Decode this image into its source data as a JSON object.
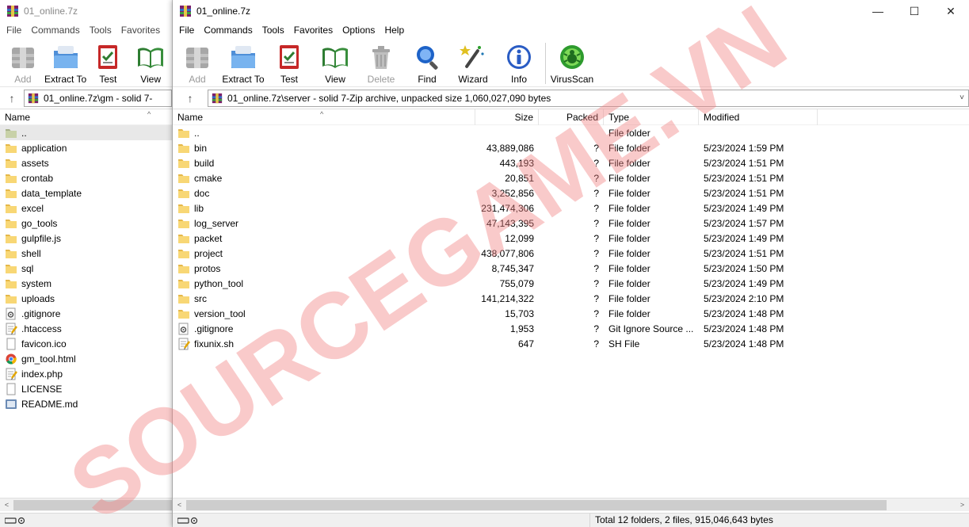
{
  "back_window": {
    "title": "01_online.7z",
    "menu": [
      "File",
      "Commands",
      "Tools",
      "Favorites"
    ],
    "toolbar": [
      {
        "label": "Add",
        "icon": "add-icon",
        "disabled": true
      },
      {
        "label": "Extract To",
        "icon": "extract-to-icon",
        "disabled": false
      },
      {
        "label": "Test",
        "icon": "test-icon",
        "disabled": false
      },
      {
        "label": "View",
        "icon": "view-icon",
        "disabled": false
      }
    ],
    "address": "01_online.7z\\gm - solid 7-",
    "column_name": "Name",
    "items": [
      {
        "name": "..",
        "kind": "up"
      },
      {
        "name": "application",
        "kind": "folder"
      },
      {
        "name": "assets",
        "kind": "folder"
      },
      {
        "name": "crontab",
        "kind": "folder"
      },
      {
        "name": "data_template",
        "kind": "folder"
      },
      {
        "name": "excel",
        "kind": "folder"
      },
      {
        "name": "go_tools",
        "kind": "folder"
      },
      {
        "name": "gulpfile.js",
        "kind": "folder"
      },
      {
        "name": "shell",
        "kind": "folder"
      },
      {
        "name": "sql",
        "kind": "folder"
      },
      {
        "name": "system",
        "kind": "folder"
      },
      {
        "name": "uploads",
        "kind": "folder"
      },
      {
        "name": ".gitignore",
        "kind": "gear"
      },
      {
        "name": ".htaccess",
        "kind": "edit"
      },
      {
        "name": "favicon.ico",
        "kind": "file"
      },
      {
        "name": "gm_tool.html",
        "kind": "chrome"
      },
      {
        "name": "index.php",
        "kind": "edit"
      },
      {
        "name": "LICENSE",
        "kind": "file"
      },
      {
        "name": "README.md",
        "kind": "md"
      }
    ]
  },
  "front_window": {
    "title": "01_online.7z",
    "window_buttons": {
      "minimize": "—",
      "maximize": "☐",
      "close": "✕"
    },
    "menu": [
      "File",
      "Commands",
      "Tools",
      "Favorites",
      "Options",
      "Help"
    ],
    "toolbar": [
      {
        "label": "Add",
        "icon": "add-icon",
        "disabled": true
      },
      {
        "label": "Extract To",
        "icon": "extract-to-icon",
        "disabled": false
      },
      {
        "label": "Test",
        "icon": "test-icon",
        "disabled": false
      },
      {
        "label": "View",
        "icon": "view-icon",
        "disabled": false
      },
      {
        "label": "Delete",
        "icon": "delete-icon",
        "disabled": true
      },
      {
        "label": "Find",
        "icon": "find-icon",
        "disabled": false
      },
      {
        "label": "Wizard",
        "icon": "wizard-icon",
        "disabled": false
      },
      {
        "label": "Info",
        "icon": "info-icon",
        "disabled": false
      },
      {
        "label": "VirusScan",
        "icon": "virusscan-icon",
        "disabled": false
      }
    ],
    "address": "01_online.7z\\server - solid 7-Zip archive, unpacked size 1,060,027,090 bytes",
    "columns": {
      "name": "Name",
      "size": "Size",
      "packed": "Packed",
      "type": "Type",
      "modified": "Modified"
    },
    "rows": [
      {
        "name": "..",
        "size": "",
        "packed": "",
        "type": "File folder",
        "modified": "",
        "kind": "folder"
      },
      {
        "name": "bin",
        "size": "43,889,086",
        "packed": "?",
        "type": "File folder",
        "modified": "5/23/2024 1:59 PM",
        "kind": "folder"
      },
      {
        "name": "build",
        "size": "443,193",
        "packed": "?",
        "type": "File folder",
        "modified": "5/23/2024 1:51 PM",
        "kind": "folder"
      },
      {
        "name": "cmake",
        "size": "20,851",
        "packed": "?",
        "type": "File folder",
        "modified": "5/23/2024 1:51 PM",
        "kind": "folder"
      },
      {
        "name": "doc",
        "size": "3,252,856",
        "packed": "?",
        "type": "File folder",
        "modified": "5/23/2024 1:51 PM",
        "kind": "folder"
      },
      {
        "name": "lib",
        "size": "231,474,306",
        "packed": "?",
        "type": "File folder",
        "modified": "5/23/2024 1:49 PM",
        "kind": "folder"
      },
      {
        "name": "log_server",
        "size": "47,143,395",
        "packed": "?",
        "type": "File folder",
        "modified": "5/23/2024 1:57 PM",
        "kind": "folder"
      },
      {
        "name": "packet",
        "size": "12,099",
        "packed": "?",
        "type": "File folder",
        "modified": "5/23/2024 1:49 PM",
        "kind": "folder"
      },
      {
        "name": "project",
        "size": "438,077,806",
        "packed": "?",
        "type": "File folder",
        "modified": "5/23/2024 1:51 PM",
        "kind": "folder"
      },
      {
        "name": "protos",
        "size": "8,745,347",
        "packed": "?",
        "type": "File folder",
        "modified": "5/23/2024 1:50 PM",
        "kind": "folder"
      },
      {
        "name": "python_tool",
        "size": "755,079",
        "packed": "?",
        "type": "File folder",
        "modified": "5/23/2024 1:49 PM",
        "kind": "folder"
      },
      {
        "name": "src",
        "size": "141,214,322",
        "packed": "?",
        "type": "File folder",
        "modified": "5/23/2024 2:10 PM",
        "kind": "folder"
      },
      {
        "name": "version_tool",
        "size": "15,703",
        "packed": "?",
        "type": "File folder",
        "modified": "5/23/2024 1:48 PM",
        "kind": "folder"
      },
      {
        "name": ".gitignore",
        "size": "1,953",
        "packed": "?",
        "type": "Git Ignore Source ...",
        "modified": "5/23/2024 1:48 PM",
        "kind": "gear"
      },
      {
        "name": "fixunix.sh",
        "size": "647",
        "packed": "?",
        "type": "SH File",
        "modified": "5/23/2024 1:48 PM",
        "kind": "edit"
      }
    ],
    "status": "Total 12 folders, 2 files, 915,046,643 bytes"
  },
  "watermark": "SOURCEGAME.VN",
  "colors": {
    "watermark": "#f08080",
    "folder": "#f8d775",
    "folder_dark": "#e5b84a",
    "selection": "#cce8ff"
  }
}
